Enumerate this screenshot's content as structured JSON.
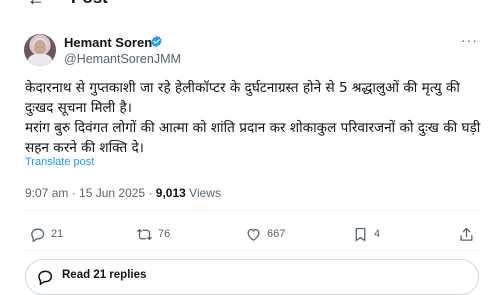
{
  "header": {
    "back_icon": "back-arrow-icon",
    "title": "Post"
  },
  "author": {
    "name": "Hemant Soren",
    "handle": "@HemantSorenJMM",
    "verified": true
  },
  "tweet": {
    "text": "केदारनाथ से गुप्तकाशी जा रहे हेलीकॉप्टर के दुर्घटनाग्रस्त होने से 5 श्रद्धालुओं की मृत्यु की दुःखद सूचना मिली है।\nमरांग बुरु दिवंगत लोगों की आत्मा को शांति प्रदान कर शोकाकुल परिवारजनों को दुःख की घड़ी सहन करने की शक्ति दे।",
    "translate_label": "Translate post",
    "time": "9:07 am",
    "date": "15 Jun 2025",
    "views_count": "9,013",
    "views_label": "Views"
  },
  "actions": {
    "replies": "21",
    "reposts": "76",
    "likes": "667",
    "bookmarks": "4"
  },
  "read_replies_label": "Read 21 replies",
  "colors": {
    "accent": "#1d9bf0",
    "secondary_text": "#536471",
    "border": "#eff3f4"
  }
}
